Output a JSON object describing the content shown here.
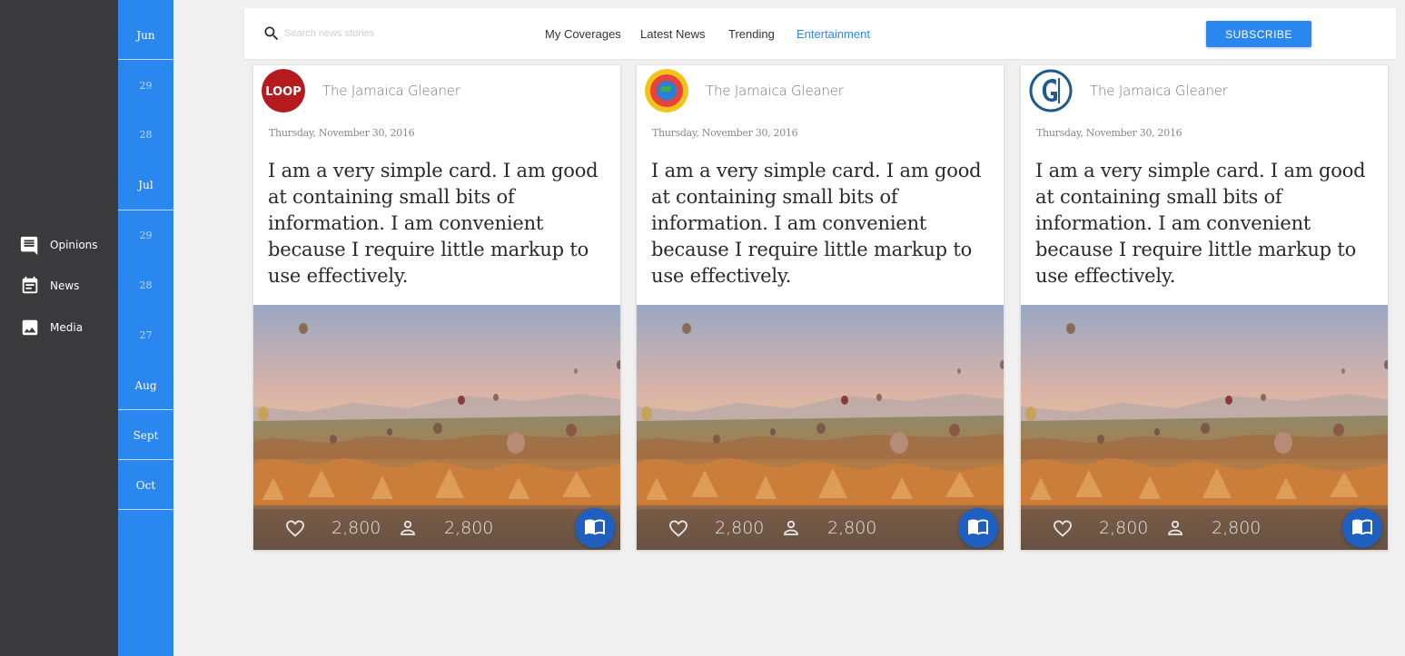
{
  "sidebar": {
    "items": [
      {
        "label": "Opinions",
        "icon": "chat-icon"
      },
      {
        "label": "News",
        "icon": "calendar-icon"
      },
      {
        "label": "Media",
        "icon": "image-icon"
      }
    ]
  },
  "timeline": {
    "items": [
      "Jun",
      "29",
      "28",
      "Jul",
      "29",
      "28",
      "27",
      "Aug",
      "Sept",
      "Oct"
    ]
  },
  "header": {
    "search_placeholder": "Search news stories",
    "nav": [
      "My Coverages",
      "Latest News",
      "Trending",
      "Entertainment"
    ],
    "active_nav": "Entertainment",
    "subscribe_label": "SUBSCRIBE"
  },
  "cards": [
    {
      "source": "The Jamaica Gleaner",
      "logo": "loop-logo",
      "date": "Thursday, November 30, 2016",
      "text": "I am a very simple card. I am good at containing small bits of information. I am convenient because I require little markup to use effectively.",
      "likes": "2,800",
      "followers": "2,800"
    },
    {
      "source": "The Jamaica Gleaner",
      "logo": "globe-logo",
      "date": "Thursday, November 30, 2016",
      "text": "I am a very simple card. I am good at containing small bits of information. I am convenient because I require little markup to use effectively.",
      "likes": "2,800",
      "followers": "2,800"
    },
    {
      "source": "The Jamaica Gleaner",
      "logo": "gleaner-logo",
      "date": "Thursday, November 30, 2016",
      "text": "I am a very simple card. I am good at containing small bits of information. I am convenient because I require little markup to use effectively.",
      "likes": "2,800",
      "followers": "2,800"
    }
  ],
  "logos": {
    "loop_text": "LOOP"
  },
  "colors": {
    "sidebar": "#3a3a3c",
    "accent": "#2b87f0",
    "fab": "#1f5fbf"
  }
}
